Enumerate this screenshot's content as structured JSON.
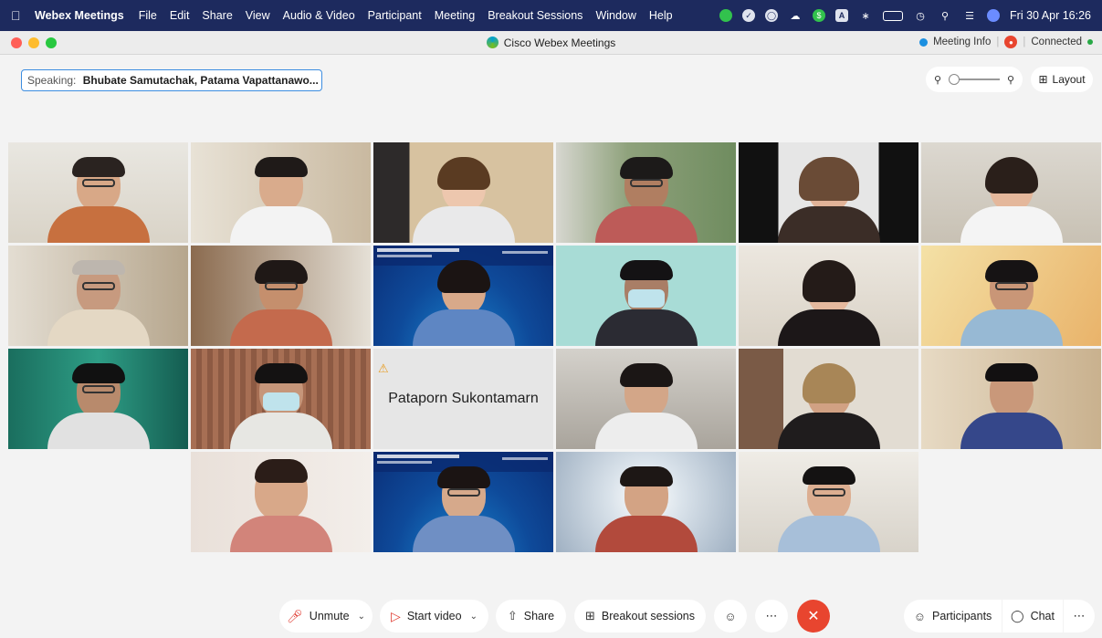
{
  "menubar": {
    "app_name": "Webex Meetings",
    "items": [
      "File",
      "Edit",
      "Share",
      "View",
      "Audio & Video",
      "Participant",
      "Meeting",
      "Breakout Sessions",
      "Window",
      "Help"
    ],
    "clock": "Fri 30 Apr  16:26",
    "tray_icons": [
      "line-icon",
      "check-icon",
      "circle-icon",
      "cloud-icon",
      "dollar-icon",
      "a-icon",
      "bluetooth-icon",
      "battery-icon",
      "wifi-icon",
      "search-icon",
      "control-center-icon",
      "siri-icon"
    ]
  },
  "window": {
    "title": "Cisco Webex Meetings",
    "meeting_info": "Meeting Info",
    "status": "Connected",
    "accent": "#1b8fe0"
  },
  "speaking": {
    "label": "Speaking:",
    "names": "Bhubate Samutachak,   Patama Vapattanawo..."
  },
  "view": {
    "layout_label": "Layout"
  },
  "grid": {
    "name_tile": "Pataporn Sukontamarn"
  },
  "toolbar": {
    "unmute": "Unmute",
    "start_video": "Start video",
    "share": "Share",
    "breakout": "Breakout sessions",
    "participants": "Participants",
    "chat": "Chat",
    "end_color": "#e8452f"
  }
}
